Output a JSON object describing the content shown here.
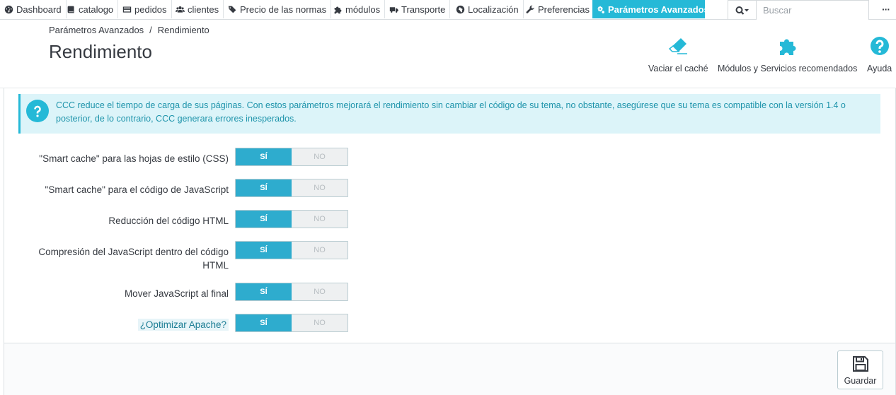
{
  "nav": {
    "items": [
      {
        "label": "Dashboard",
        "icon": "dashboard-icon"
      },
      {
        "label": "catalogo",
        "icon": "book-icon"
      },
      {
        "label": "pedidos",
        "icon": "credit-card-icon"
      },
      {
        "label": "clientes",
        "icon": "users-icon"
      },
      {
        "label": "Precio de las normas",
        "icon": "tags-icon"
      },
      {
        "label": "módulos",
        "icon": "puzzle-icon"
      },
      {
        "label": "Transporte",
        "icon": "truck-icon"
      },
      {
        "label": "Localización",
        "icon": "globe-icon"
      },
      {
        "label": "Preferencias",
        "icon": "wrench-icon"
      },
      {
        "label": "Parámetros Avanzados",
        "icon": "cogs-icon"
      }
    ],
    "active_index": 9,
    "search_placeholder": "Buscar",
    "more": "···"
  },
  "header": {
    "breadcrumb": [
      "Parámetros Avanzados",
      "Rendimiento"
    ],
    "title": "Rendimiento",
    "toolbar": [
      {
        "label": "Vaciar el caché",
        "icon": "eraser-icon"
      },
      {
        "label": "Módulos y Servicios recomendados",
        "icon": "puzzle-icon"
      },
      {
        "label": "Ayuda",
        "icon": "help-icon"
      }
    ]
  },
  "alert": {
    "text": "CCC reduce el tiempo de carga de sus páginas. Con estos parámetros mejorará el rendimiento sin cambiar el código de su tema, no obstante, asegúrese que su tema es compatible con la versión 1.4 o posterior, de lo contrario, CCC generara errores inesperados."
  },
  "form": {
    "yes_label": "SÍ",
    "no_label": "NO",
    "rows": [
      {
        "label": "\"Smart cache\" para las hojas de estilo (CSS)",
        "value": "SÍ"
      },
      {
        "label": "\"Smart cache\" para el código de JavaScript",
        "value": "SÍ"
      },
      {
        "label": "Reducción del código HTML",
        "value": "SÍ"
      },
      {
        "label": "Compresión del JavaScript dentro del código HTML",
        "value": "SÍ"
      },
      {
        "label": "Mover JavaScript al final",
        "value": "SÍ"
      },
      {
        "label": "¿Optimizar Apache?",
        "value": "SÍ"
      }
    ]
  },
  "footer": {
    "save_label": "Guardar"
  },
  "colors": {
    "accent": "#25b9d7",
    "switch_on": "#2eacce",
    "alert_bg": "#dcf4f9",
    "alert_text": "#1e94ab"
  }
}
